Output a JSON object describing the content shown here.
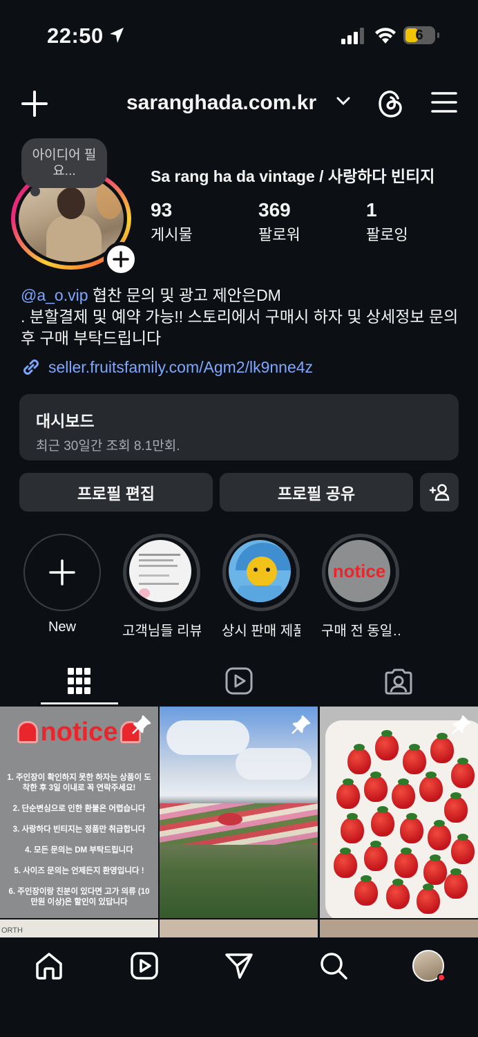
{
  "status_bar": {
    "time": "22:50",
    "battery": "6"
  },
  "header": {
    "username": "saranghada.com.kr"
  },
  "note": {
    "text": "아이디어 필요..."
  },
  "profile": {
    "display_name": "Sa rang ha da vintage / 사랑하다 빈티지",
    "stats": [
      {
        "value": "93",
        "label": "게시물"
      },
      {
        "value": "369",
        "label": "팔로워"
      },
      {
        "value": "1",
        "label": "팔로잉"
      }
    ],
    "bio_mention": "@a_o.vip",
    "bio_line1_rest": " 협찬 문의 및 광고 제안은DM",
    "bio_line2": ". 분할결제 및 예약 가능!! 스토리에서 구매시 하자 및 상세정보 문의 후 구매 부탁드립니다",
    "link": "seller.fruitsfamily.com/Agm2/lk9nne4z"
  },
  "dashboard": {
    "title": "대시보드",
    "subtitle": "최근 30일간 조회 8.1만회."
  },
  "buttons": {
    "edit": "프로필 편집",
    "share": "프로필 공유"
  },
  "highlights": [
    {
      "label": "New"
    },
    {
      "label": "고객님들 리뷰"
    },
    {
      "label": "상시 판매 제품"
    },
    {
      "label": "구매 전 동일…",
      "thumb_text": "notice"
    }
  ],
  "grid": {
    "notice_title": "notice",
    "notice_items": [
      "1. 주인장이 확인하지 못한 하자는 상품이 도착한 후 3일 이내로 꼭 연락주세요!",
      "2. 단순변심으로 인한 환불은 어렵습니다",
      "3. 사랑하다 빈티지는 정품만 취급합니다",
      "4. 모든 문의는 DM 부탁드립니다",
      "5. 사이즈 문의는 언제든지 환영입니다 !",
      "6. 주인장이랑 친분이 있다면 고가 의류 (10만원 이상)은 할인이 있답니다"
    ],
    "row2_text": "ORTH"
  },
  "colors": {
    "accent_link": "#7ea7ff",
    "background": "#0c1014",
    "notice_red": "#e8262b"
  }
}
